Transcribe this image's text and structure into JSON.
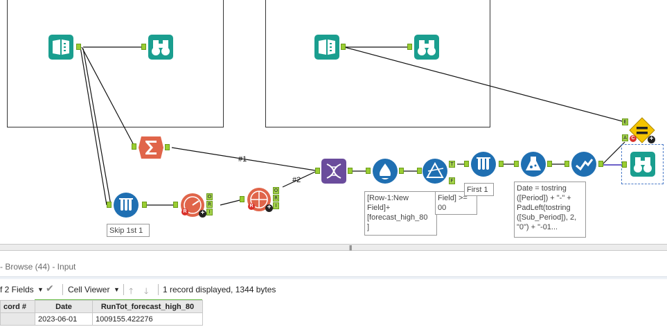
{
  "canvas": {
    "connection_labels": [
      "#1",
      "#2"
    ],
    "annotations": {
      "skip": "Skip 1st 1",
      "formula_rowfield": "[Row-1:New\nField]+\n[forecast_high_80\n]",
      "filter_expr": "Field] >=\n00",
      "first": "First 1",
      "date_formula": "Date = tostring\n([Period]) + \"-\" +\nPadLeft(tostring\n([Sub_Period]), 2,\n\"0\") + \"-01..."
    },
    "anchor_letters": {
      "filter_true": "T",
      "filter_false": "F",
      "join_o1": "O",
      "join_r1": "R",
      "join_i1": "I",
      "join_o2": "O",
      "join_r2": "R",
      "join_i2": "I",
      "test_e": "E",
      "test_a": "A",
      "test_c": "C"
    },
    "badges": {
      "plus": "+",
      "circle_r": "R"
    }
  },
  "splitter": {
    "grip": "|||"
  },
  "results": {
    "title": "- Browse (44) - Input",
    "toolbar": {
      "fields": "f 2 Fields",
      "viewer": "Cell Viewer",
      "status": "1 record displayed, 1344 bytes"
    },
    "columns": [
      "cord #",
      "Date",
      "RunTot_forecast_high_80"
    ],
    "rows": [
      [
        "",
        "2023-06-01",
        "1009155.422276"
      ]
    ]
  },
  "colors": {
    "teal": "#1a9e8f",
    "orange": "#e0654a",
    "purple": "#6a4c9c",
    "blue_tool": "#1f6fb2",
    "yellow": "#f4c400",
    "anchor_green": "#9acd32"
  }
}
